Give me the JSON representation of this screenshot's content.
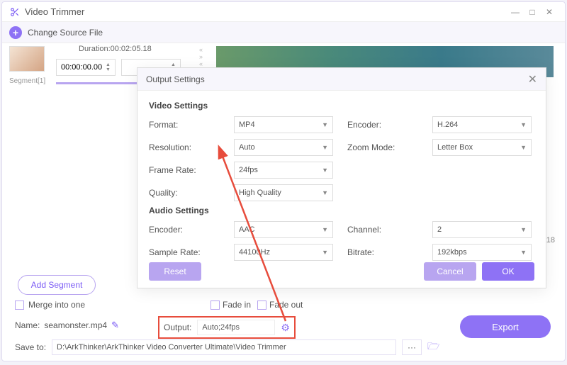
{
  "window": {
    "title": "Video Trimmer"
  },
  "toolbar": {
    "change_source": "Change Source File"
  },
  "duration": {
    "label": "Duration:00:02:05.18",
    "start": "00:00:00.00"
  },
  "segment_label": "Segment[1]",
  "side_time": ".18",
  "add_segment": "Add Segment",
  "merge_label": "Merge into one",
  "fade_in": "Fade in",
  "fade_out": "Fade out",
  "name": {
    "label": "Name:",
    "value": "seamonster.mp4"
  },
  "output": {
    "label": "Output:",
    "value": "Auto;24fps"
  },
  "export_label": "Export",
  "saveto": {
    "label": "Save to:",
    "value": "D:\\ArkThinker\\ArkThinker Video Converter Ultimate\\Video Trimmer"
  },
  "modal": {
    "title": "Output Settings",
    "video_h": "Video Settings",
    "audio_h": "Audio Settings",
    "fields": {
      "format": {
        "label": "Format:",
        "value": "MP4"
      },
      "encoder_v": {
        "label": "Encoder:",
        "value": "H.264"
      },
      "resolution": {
        "label": "Resolution:",
        "value": "Auto"
      },
      "zoom": {
        "label": "Zoom Mode:",
        "value": "Letter Box"
      },
      "framerate": {
        "label": "Frame Rate:",
        "value": "24fps"
      },
      "quality": {
        "label": "Quality:",
        "value": "High Quality"
      },
      "encoder_a": {
        "label": "Encoder:",
        "value": "AAC"
      },
      "channel": {
        "label": "Channel:",
        "value": "2"
      },
      "samplerate": {
        "label": "Sample Rate:",
        "value": "44100Hz"
      },
      "bitrate": {
        "label": "Bitrate:",
        "value": "192kbps"
      }
    },
    "reset": "Reset",
    "cancel": "Cancel",
    "ok": "OK"
  }
}
